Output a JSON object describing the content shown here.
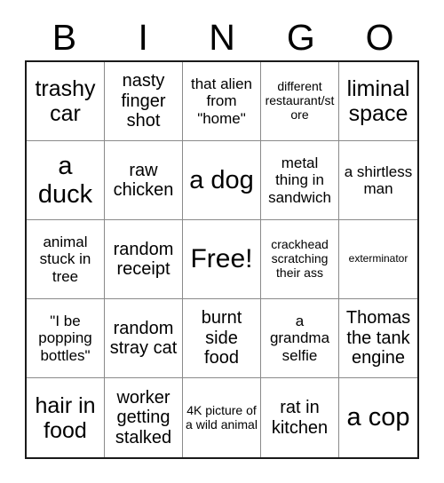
{
  "header": {
    "letters": [
      "B",
      "I",
      "N",
      "G",
      "O"
    ]
  },
  "grid": {
    "rows": 5,
    "columns": 5,
    "free_space_index": 12,
    "cells": [
      {
        "text": "trashy car",
        "size": "lg"
      },
      {
        "text": "nasty finger shot",
        "size": "md"
      },
      {
        "text": "that alien from \"home\"",
        "size": "sm"
      },
      {
        "text": "different restaurant/store",
        "size": "xs"
      },
      {
        "text": "liminal space",
        "size": "lg"
      },
      {
        "text": "a duck",
        "size": "xl"
      },
      {
        "text": "raw chicken",
        "size": "md"
      },
      {
        "text": "a dog",
        "size": "xl"
      },
      {
        "text": "metal thing in sandwich",
        "size": "sm"
      },
      {
        "text": "a shirtless man",
        "size": "sm"
      },
      {
        "text": "animal stuck in tree",
        "size": "sm"
      },
      {
        "text": "random receipt",
        "size": "md"
      },
      {
        "text": "Free!",
        "size": "free"
      },
      {
        "text": "crackhead scratching their ass",
        "size": "xs"
      },
      {
        "text": "exterminator",
        "size": "xxs"
      },
      {
        "text": "\"I be popping bottles\"",
        "size": "sm"
      },
      {
        "text": "random stray cat",
        "size": "md"
      },
      {
        "text": "burnt side food",
        "size": "md"
      },
      {
        "text": "a grandma selfie",
        "size": "sm"
      },
      {
        "text": "Thomas the tank engine",
        "size": "md"
      },
      {
        "text": "hair in food",
        "size": "lg"
      },
      {
        "text": "worker getting stalked",
        "size": "md"
      },
      {
        "text": "4K picture of a wild animal",
        "size": "xs"
      },
      {
        "text": "rat in kitchen",
        "size": "md"
      },
      {
        "text": "a cop",
        "size": "xl"
      }
    ]
  },
  "colors": {
    "background": "#ffffff",
    "text": "#000000",
    "outer_border": "#1a1a1a",
    "inner_border": "#8a8a8a"
  }
}
